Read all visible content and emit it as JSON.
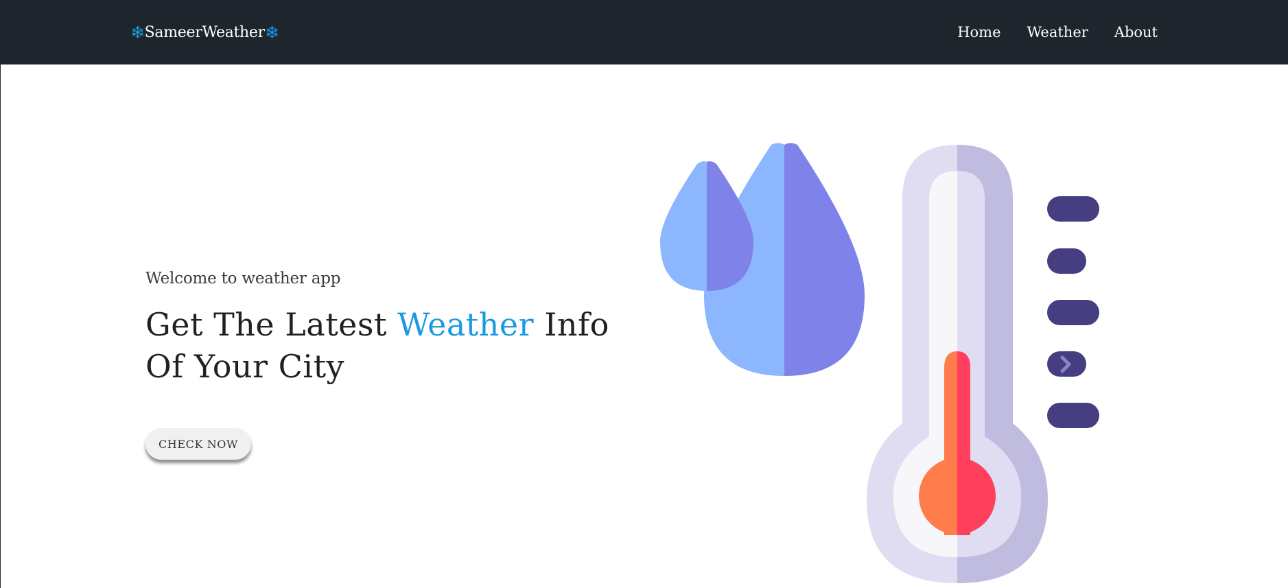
{
  "navbar": {
    "brand_icon_left": "❄",
    "brand_name": "SameerWeather",
    "brand_icon_right": "❄",
    "links": [
      {
        "label": "Home"
      },
      {
        "label": "Weather"
      },
      {
        "label": "About"
      }
    ]
  },
  "hero": {
    "welcome": "Welcome to weather app",
    "headline_before": "Get The Latest ",
    "headline_accent": "Weather",
    "headline_after": " Info Of Your City",
    "cta_label": "CHECK NOW"
  },
  "illustration": {
    "icons": [
      "raindrop-icon",
      "thermometer-icon",
      "temperature-scale-marks"
    ]
  },
  "colors": {
    "navbar_bg": "#1f252d",
    "accent": "#1a9ae0",
    "drop_light": "#8cb6fd",
    "drop_dark": "#7f83e9",
    "thermo_light": "#e0ddf3",
    "thermo_shade": "#bfbcdf",
    "mercury_orange": "#ff7d4c",
    "mercury_red": "#ff3f5b",
    "scale_marks": "#453e80"
  }
}
